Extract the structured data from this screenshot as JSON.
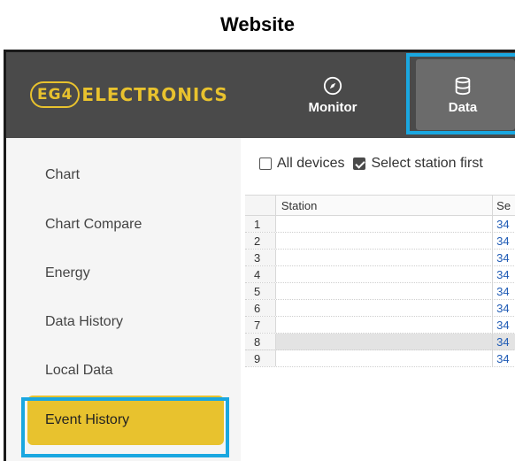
{
  "caption": "Website",
  "header": {
    "logo_badge": "EG4",
    "logo_text": "ELECTRONICS",
    "nav": [
      {
        "label": "Monitor",
        "icon": "compass-icon"
      },
      {
        "label": "Data",
        "icon": "database-icon"
      }
    ]
  },
  "sidebar": {
    "items": [
      {
        "label": "Chart"
      },
      {
        "label": "Chart Compare"
      },
      {
        "label": "Energy"
      },
      {
        "label": "Data History"
      },
      {
        "label": "Local Data"
      },
      {
        "label": "Event History",
        "active": true
      }
    ]
  },
  "filters": {
    "all_devices": {
      "label": "All devices",
      "checked": false
    },
    "select_station": {
      "label": "Select station first",
      "checked": true
    }
  },
  "table": {
    "columns": [
      "Station",
      "Se"
    ],
    "rows": [
      {
        "num": "1",
        "station": "",
        "serial": "34"
      },
      {
        "num": "2",
        "station": "",
        "serial": "34"
      },
      {
        "num": "3",
        "station": "",
        "serial": "34"
      },
      {
        "num": "4",
        "station": "",
        "serial": "34"
      },
      {
        "num": "5",
        "station": "",
        "serial": "34"
      },
      {
        "num": "6",
        "station": "",
        "serial": "34"
      },
      {
        "num": "7",
        "station": "",
        "serial": "34"
      },
      {
        "num": "8",
        "station": "",
        "serial": "34",
        "selected": true
      },
      {
        "num": "9",
        "station": "",
        "serial": "34"
      }
    ]
  },
  "colors": {
    "accent": "#e8c22e",
    "header_bg": "#4a4a4a",
    "highlight": "#1aa7e0"
  }
}
